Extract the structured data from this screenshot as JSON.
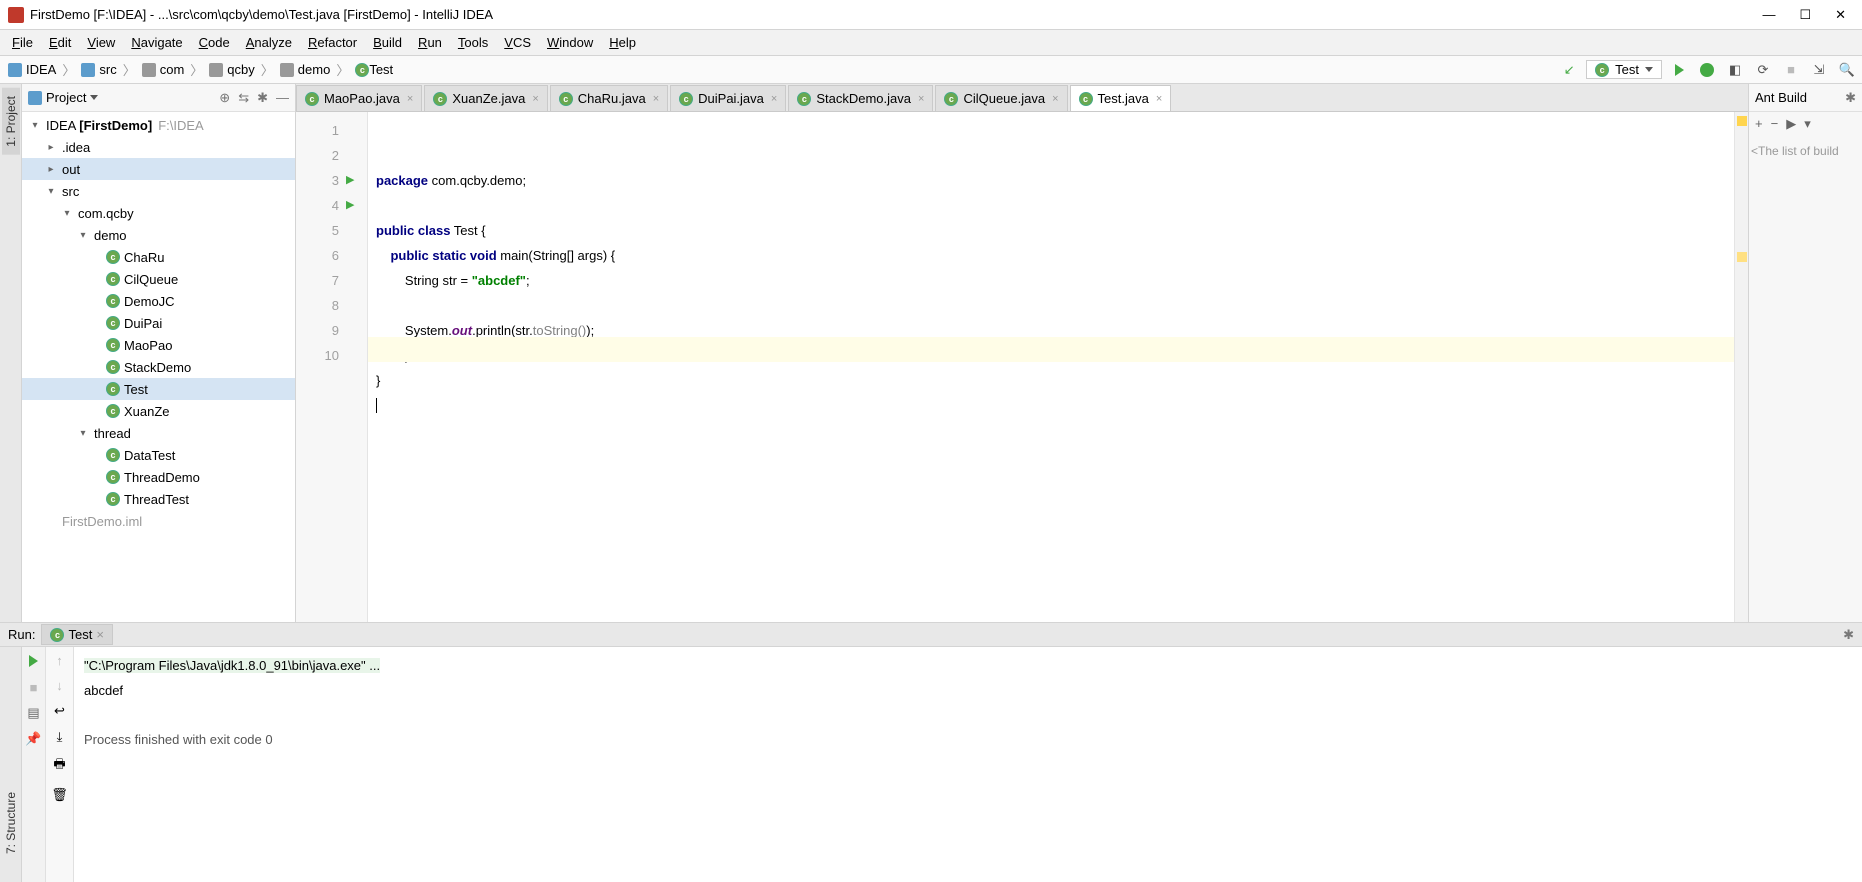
{
  "window": {
    "title": "FirstDemo [F:\\IDEA] - ...\\src\\com\\qcby\\demo\\Test.java [FirstDemo] - IntelliJ IDEA"
  },
  "menu": [
    "File",
    "Edit",
    "View",
    "Navigate",
    "Code",
    "Analyze",
    "Refactor",
    "Build",
    "Run",
    "Tools",
    "VCS",
    "Window",
    "Help"
  ],
  "breadcrumbs": [
    {
      "label": "IDEA",
      "type": "folder-b"
    },
    {
      "label": "src",
      "type": "folder-b"
    },
    {
      "label": "com",
      "type": "pkg"
    },
    {
      "label": "qcby",
      "type": "pkg"
    },
    {
      "label": "demo",
      "type": "pkg"
    },
    {
      "label": "Test",
      "type": "class"
    }
  ],
  "run_config": "Test",
  "project_pane": {
    "title": "Project"
  },
  "tree": [
    {
      "d": 0,
      "arrow": "▾",
      "icon": "folder-b",
      "label": "IDEA",
      "bold": "[FirstDemo]",
      "dim": "F:\\IDEA"
    },
    {
      "d": 1,
      "arrow": "▸",
      "icon": "folder-o",
      "label": ".idea"
    },
    {
      "d": 1,
      "arrow": "▸",
      "icon": "folder-o",
      "label": "out",
      "sel": true
    },
    {
      "d": 1,
      "arrow": "▾",
      "icon": "folder-b",
      "label": "src"
    },
    {
      "d": 2,
      "arrow": "▾",
      "icon": "pkg",
      "label": "com.qcby"
    },
    {
      "d": 3,
      "arrow": "▾",
      "icon": "pkg",
      "label": "demo"
    },
    {
      "d": 4,
      "arrow": "",
      "icon": "class",
      "label": "ChaRu"
    },
    {
      "d": 4,
      "arrow": "",
      "icon": "class",
      "label": "CilQueue"
    },
    {
      "d": 4,
      "arrow": "",
      "icon": "class",
      "label": "DemoJC"
    },
    {
      "d": 4,
      "arrow": "",
      "icon": "class",
      "label": "DuiPai"
    },
    {
      "d": 4,
      "arrow": "",
      "icon": "class",
      "label": "MaoPao"
    },
    {
      "d": 4,
      "arrow": "",
      "icon": "class",
      "label": "StackDemo"
    },
    {
      "d": 4,
      "arrow": "",
      "icon": "class",
      "label": "Test",
      "sel": true
    },
    {
      "d": 4,
      "arrow": "",
      "icon": "class",
      "label": "XuanZe"
    },
    {
      "d": 3,
      "arrow": "▾",
      "icon": "pkg",
      "label": "thread"
    },
    {
      "d": 4,
      "arrow": "",
      "icon": "class",
      "label": "DataTest"
    },
    {
      "d": 4,
      "arrow": "",
      "icon": "class",
      "label": "ThreadDemo"
    },
    {
      "d": 4,
      "arrow": "",
      "icon": "class",
      "label": "ThreadTest"
    },
    {
      "d": 1,
      "arrow": "",
      "icon": "iml",
      "label": "FirstDemo.iml",
      "dimlabel": true
    }
  ],
  "editor_tabs": [
    {
      "label": "MaoPao.java"
    },
    {
      "label": "XuanZe.java"
    },
    {
      "label": "ChaRu.java"
    },
    {
      "label": "DuiPai.java"
    },
    {
      "label": "StackDemo.java"
    },
    {
      "label": "CilQueue.java"
    },
    {
      "label": "Test.java",
      "active": true
    }
  ],
  "code": {
    "lines": [
      1,
      2,
      3,
      4,
      5,
      6,
      7,
      8,
      9,
      10
    ],
    "l1_kw": "package",
    "l1_rest": " com.qcby.demo;",
    "l3_kw1": "public class",
    "l3_rest": " Test {",
    "l4_indent": "    ",
    "l4_kw": "public static void",
    "l4_rest": " main(String[] args) {",
    "l5_indent": "        String str = ",
    "l5_str": "\"abcdef\"",
    "l5_end": ";",
    "l7_indent": "        System.",
    "l7_field": "out",
    "l7_mid": ".println(str.",
    "l7_dim": "toString()",
    "l7_end": ");",
    "l8": "        }",
    "l9": "}",
    "caret_line": 10
  },
  "ant": {
    "title": "Ant Build",
    "empty": "<The list of build"
  },
  "run": {
    "label": "Run:",
    "tab": "Test",
    "cmd": "\"C:\\Program Files\\Java\\jdk1.8.0_91\\bin\\java.exe\" ...",
    "out": "abcdef",
    "exit": "Process finished with exit code 0"
  },
  "side_tabs": {
    "project": "1: Project",
    "structure": "7: Structure"
  }
}
